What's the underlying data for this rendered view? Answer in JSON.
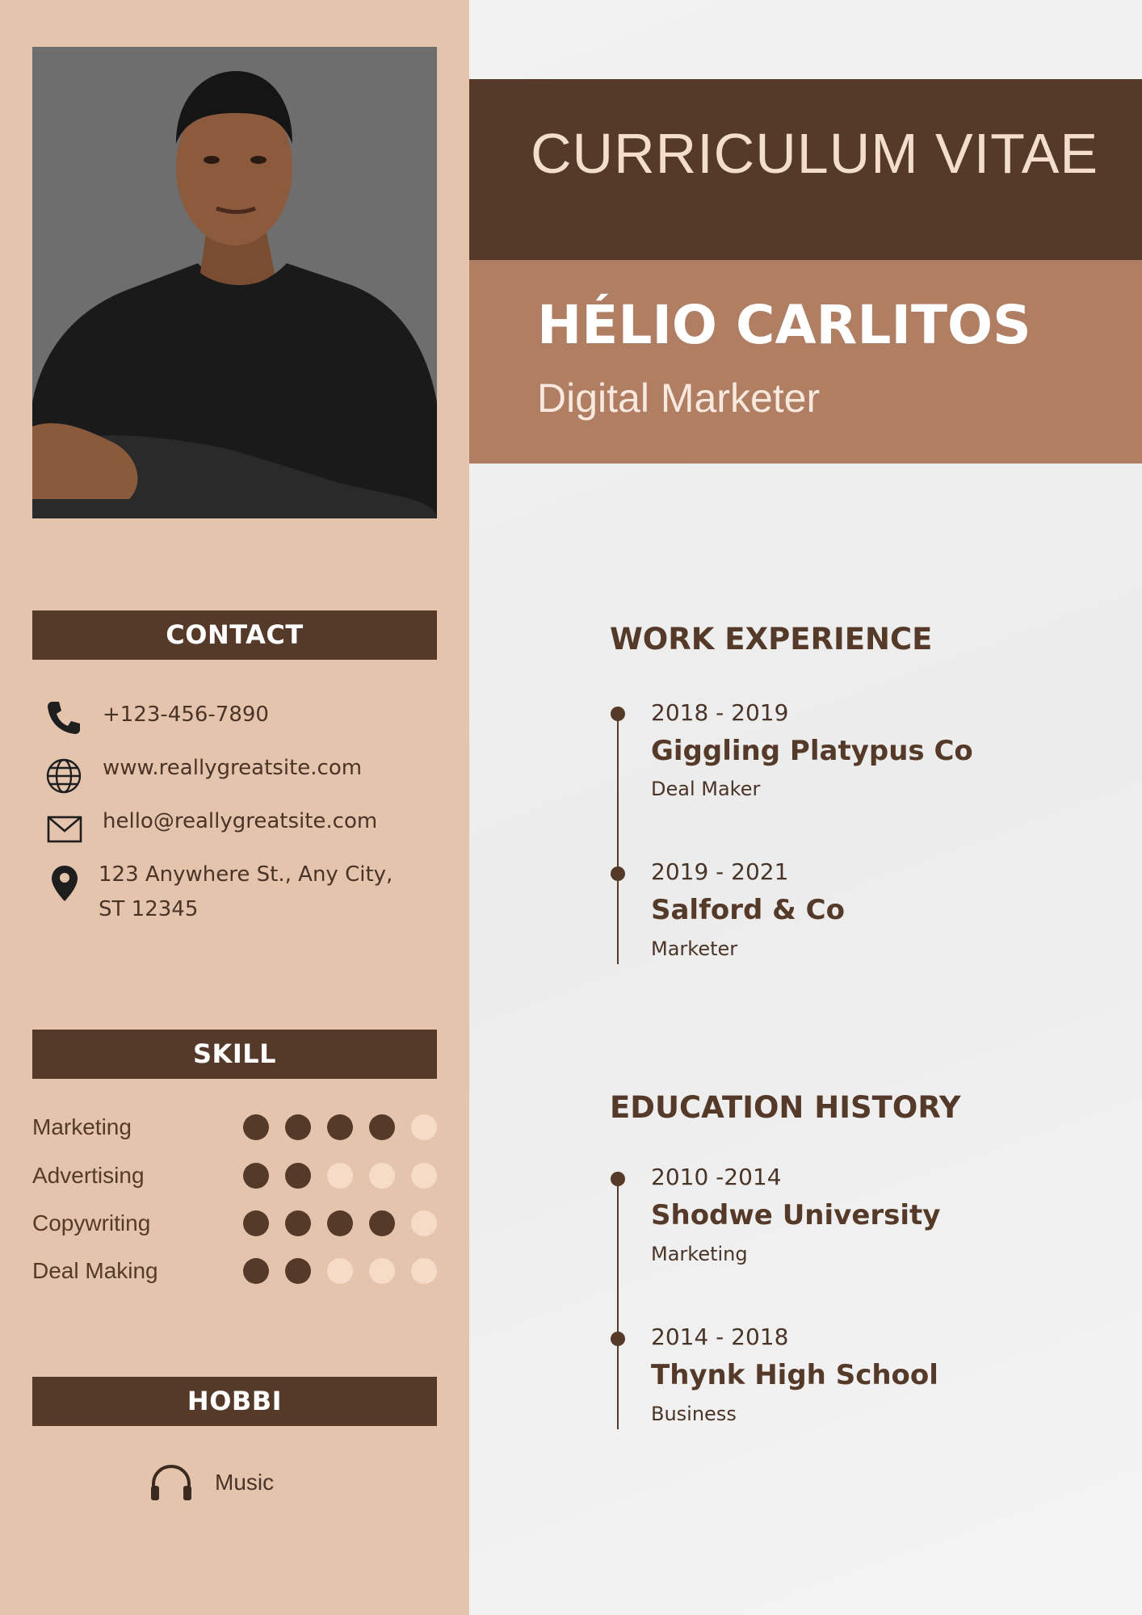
{
  "header": {
    "cv_title": "CURRICULUM VITAE",
    "name": "HÉLIO CARLITOS",
    "role": "Digital Marketer"
  },
  "contact": {
    "heading": "CONTACT",
    "phone": "+123-456-7890",
    "website": "www.reallygreatsite.com",
    "email": "hello@reallygreatsite.com",
    "address_line1": "123 Anywhere St., Any City,",
    "address_line2": "ST 12345"
  },
  "skill": {
    "heading": "SKILL",
    "items": [
      {
        "name": "Marketing",
        "level": 4,
        "max": 5
      },
      {
        "name": "Advertising",
        "level": 2,
        "max": 5
      },
      {
        "name": "Copywriting",
        "level": 4,
        "max": 5
      },
      {
        "name": "Deal Making",
        "level": 2,
        "max": 5
      }
    ]
  },
  "hobbi": {
    "heading": "HOBBI",
    "items": [
      {
        "name": "Music",
        "icon": "headphones-icon"
      }
    ]
  },
  "work": {
    "heading": "WORK EXPERIENCE",
    "items": [
      {
        "years": "2018 - 2019",
        "org": "Giggling Platypus Co",
        "title": "Deal Maker"
      },
      {
        "years": "2019 - 2021",
        "org": "Salford & Co",
        "title": "Marketer"
      }
    ]
  },
  "education": {
    "heading": "EDUCATION HISTORY",
    "items": [
      {
        "years": "2010 -2014",
        "org": "Shodwe University",
        "title": "Marketing"
      },
      {
        "years": "2014 - 2018",
        "org": "Thynk High School",
        "title": "Business"
      }
    ]
  },
  "colors": {
    "sidebar": "#e5c4ae",
    "dark_brown": "#553a29",
    "mid_brown": "#b07e63",
    "dot_off": "#f6dcc8"
  }
}
